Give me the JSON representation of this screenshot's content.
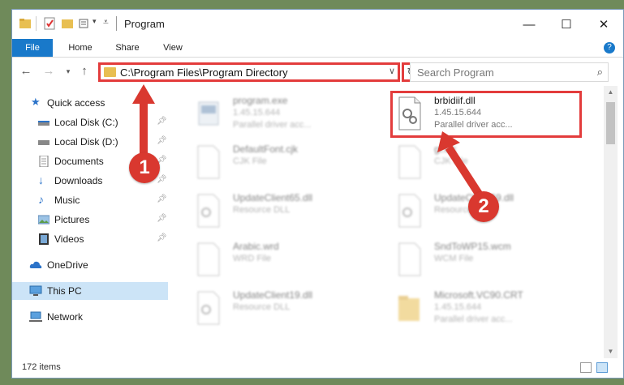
{
  "window": {
    "title": "Program"
  },
  "ribbon": {
    "tabs": [
      "File",
      "Home",
      "Share",
      "View"
    ]
  },
  "nav": {
    "address": "C:\\Program Files\\Program Directory",
    "search_placeholder": "Search Program"
  },
  "sidebar": {
    "items": [
      {
        "label": "Quick access",
        "icon": "star-icon"
      },
      {
        "label": "Local Disk (C:)",
        "icon": "drive-icon",
        "pinned": true
      },
      {
        "label": "Local Disk (D:)",
        "icon": "drive-icon",
        "pinned": true
      },
      {
        "label": "Documents",
        "icon": "documents-icon",
        "pinned": true
      },
      {
        "label": "Downloads",
        "icon": "download-icon",
        "pinned": true
      },
      {
        "label": "Music",
        "icon": "music-icon",
        "pinned": true
      },
      {
        "label": "Pictures",
        "icon": "pictures-icon",
        "pinned": true
      },
      {
        "label": "Videos",
        "icon": "videos-icon",
        "pinned": true
      },
      {
        "label": "OneDrive",
        "icon": "cloud-icon"
      },
      {
        "label": "This PC",
        "icon": "computer-icon",
        "selected": true
      },
      {
        "label": "Network",
        "icon": "network-icon"
      }
    ]
  },
  "files": [
    {
      "name": "program.exe",
      "line2": "1.45.15.644",
      "line3": "Parallel driver acc..."
    },
    {
      "name": "brbidiif.dll",
      "line2": "1.45.15.644",
      "line3": "Parallel driver acc...",
      "highlighted": true
    },
    {
      "name": "DefaultFont.cjk",
      "line2": "CJK File",
      "line3": ""
    },
    {
      "name": "gl.cjk",
      "line2": "CJK File",
      "line3": ""
    },
    {
      "name": "UpdateClient65.dll",
      "line2": "Resource DLL",
      "line3": ""
    },
    {
      "name": "UpdateClient69.dll",
      "line2": "Resource DLL",
      "line3": ""
    },
    {
      "name": "Arabic.wrd",
      "line2": "WRD File",
      "line3": ""
    },
    {
      "name": "SndToWP15.wcm",
      "line2": "WCM File",
      "line3": ""
    },
    {
      "name": "UpdateClient19.dll",
      "line2": "Resource DLL",
      "line3": ""
    },
    {
      "name": "Microsoft.VC90.CRT",
      "line2": "1.45.15.644",
      "line3": "Parallel driver acc..."
    }
  ],
  "status": {
    "item_count": "172 items"
  },
  "annotations": {
    "step1": "1",
    "step2": "2"
  },
  "colors": {
    "accent": "#1979ca",
    "highlight": "#e33c3c",
    "selection": "#cce4f7"
  }
}
